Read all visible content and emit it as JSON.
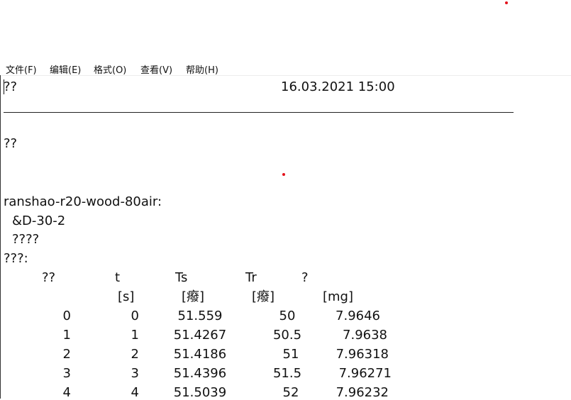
{
  "menu": [
    {
      "label": "文件(F)"
    },
    {
      "label": "编辑(E)"
    },
    {
      "label": "格式(O)"
    },
    {
      "label": "查看(V)"
    },
    {
      "label": "帮助(H)"
    }
  ],
  "document": {
    "line1_left": "??",
    "line1_date": "16.03.2021 15:00",
    "line2": "??",
    "filename": "ranshao-r20-wood-80air:",
    "sample_id": "&D-30-2",
    "line_q4": "????",
    "line_q3": "???:"
  },
  "table": {
    "headers": [
      "??",
      "t",
      "Ts",
      "Tr",
      "?"
    ],
    "units": [
      "",
      "[s]",
      "[癈]",
      "[癈]",
      "[mg]"
    ],
    "rows": [
      [
        "0",
        "0",
        "51.559",
        "50",
        "7.9646"
      ],
      [
        "1",
        "1",
        "51.4267",
        "50.5",
        "7.9638"
      ],
      [
        "2",
        "2",
        "51.4186",
        "51",
        "7.96318"
      ],
      [
        "3",
        "3",
        "51.4396",
        "51.5",
        "7.96271"
      ],
      [
        "4",
        "4",
        "51.5039",
        "52",
        "7.96232"
      ]
    ]
  },
  "colors": {
    "dot": "#e3121b"
  }
}
